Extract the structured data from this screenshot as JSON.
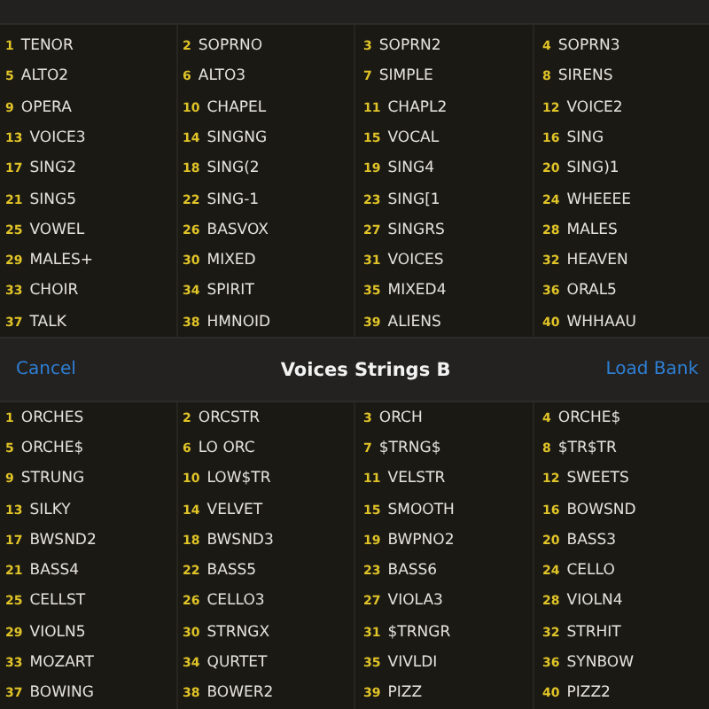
{
  "upper_bank": {
    "presets": [
      {
        "number": "1",
        "name": "TENOR"
      },
      {
        "number": "2",
        "name": "SOPRNO"
      },
      {
        "number": "3",
        "name": "SOPRN2"
      },
      {
        "number": "4",
        "name": "SOPRN3"
      },
      {
        "number": "5",
        "name": "ALTO2"
      },
      {
        "number": "6",
        "name": "ALTO3"
      },
      {
        "number": "7",
        "name": "SIMPLE"
      },
      {
        "number": "8",
        "name": "SIRENS"
      },
      {
        "number": "9",
        "name": "OPERA"
      },
      {
        "number": "10",
        "name": "CHAPEL"
      },
      {
        "number": "11",
        "name": "CHAPL2"
      },
      {
        "number": "12",
        "name": "VOICE2"
      },
      {
        "number": "13",
        "name": "VOICE3"
      },
      {
        "number": "14",
        "name": "SINGNG"
      },
      {
        "number": "15",
        "name": "VOCAL"
      },
      {
        "number": "16",
        "name": "SING"
      },
      {
        "number": "17",
        "name": "SING2"
      },
      {
        "number": "18",
        "name": "SING(2"
      },
      {
        "number": "19",
        "name": "SING4"
      },
      {
        "number": "20",
        "name": "SING)1"
      },
      {
        "number": "21",
        "name": "SING5"
      },
      {
        "number": "22",
        "name": "SING-1"
      },
      {
        "number": "23",
        "name": "SING[1"
      },
      {
        "number": "24",
        "name": "WHEEEE"
      },
      {
        "number": "25",
        "name": "VOWEL"
      },
      {
        "number": "26",
        "name": "BASVOX"
      },
      {
        "number": "27",
        "name": "SINGRS"
      },
      {
        "number": "28",
        "name": "MALES"
      },
      {
        "number": "29",
        "name": "MALES+"
      },
      {
        "number": "30",
        "name": "MIXED"
      },
      {
        "number": "31",
        "name": "VOICES"
      },
      {
        "number": "32",
        "name": "HEAVEN"
      },
      {
        "number": "33",
        "name": "CHOIR"
      },
      {
        "number": "34",
        "name": "SPIRIT"
      },
      {
        "number": "35",
        "name": "MIXED4"
      },
      {
        "number": "36",
        "name": "ORAL5"
      },
      {
        "number": "37",
        "name": "TALK"
      },
      {
        "number": "38",
        "name": "HMNOID"
      },
      {
        "number": "39",
        "name": "ALIENS"
      },
      {
        "number": "40",
        "name": "WHHAAU"
      }
    ]
  },
  "dialog_bar": {
    "cancel": "Cancel",
    "title": "Voices Strings B",
    "load": "Load Bank"
  },
  "lower_bank": {
    "presets": [
      {
        "number": "1",
        "name": "ORCHES"
      },
      {
        "number": "2",
        "name": "ORCSTR"
      },
      {
        "number": "3",
        "name": "ORCH"
      },
      {
        "number": "4",
        "name": "ORCHE$"
      },
      {
        "number": "5",
        "name": "ORCHE$"
      },
      {
        "number": "6",
        "name": "LO ORC"
      },
      {
        "number": "7",
        "name": "$TRNG$"
      },
      {
        "number": "8",
        "name": "$TR$TR"
      },
      {
        "number": "9",
        "name": "STRUNG"
      },
      {
        "number": "10",
        "name": "LOW$TR"
      },
      {
        "number": "11",
        "name": "VELSTR"
      },
      {
        "number": "12",
        "name": "SWEETS"
      },
      {
        "number": "13",
        "name": "SILKY"
      },
      {
        "number": "14",
        "name": "VELVET"
      },
      {
        "number": "15",
        "name": "SMOOTH"
      },
      {
        "number": "16",
        "name": "BOWSND"
      },
      {
        "number": "17",
        "name": "BWSND2"
      },
      {
        "number": "18",
        "name": "BWSND3"
      },
      {
        "number": "19",
        "name": "BWPNO2"
      },
      {
        "number": "20",
        "name": "BASS3"
      },
      {
        "number": "21",
        "name": "BASS4"
      },
      {
        "number": "22",
        "name": "BASS5"
      },
      {
        "number": "23",
        "name": "BASS6"
      },
      {
        "number": "24",
        "name": "CELLO"
      },
      {
        "number": "25",
        "name": "CELLST"
      },
      {
        "number": "26",
        "name": "CELLO3"
      },
      {
        "number": "27",
        "name": "VIOLA3"
      },
      {
        "number": "28",
        "name": "VIOLN4"
      },
      {
        "number": "29",
        "name": "VIOLN5"
      },
      {
        "number": "30",
        "name": "STRNGX"
      },
      {
        "number": "31",
        "name": "$TRNGR"
      },
      {
        "number": "32",
        "name": "STRHIT"
      },
      {
        "number": "33",
        "name": "MOZART"
      },
      {
        "number": "34",
        "name": "QURTET"
      },
      {
        "number": "35",
        "name": "VIVLDI"
      },
      {
        "number": "36",
        "name": "SYNBOW"
      },
      {
        "number": "37",
        "name": "BOWING"
      },
      {
        "number": "38",
        "name": "BOWER2"
      },
      {
        "number": "39",
        "name": "PIZZ"
      },
      {
        "number": "40",
        "name": "PIZZ2"
      }
    ]
  }
}
